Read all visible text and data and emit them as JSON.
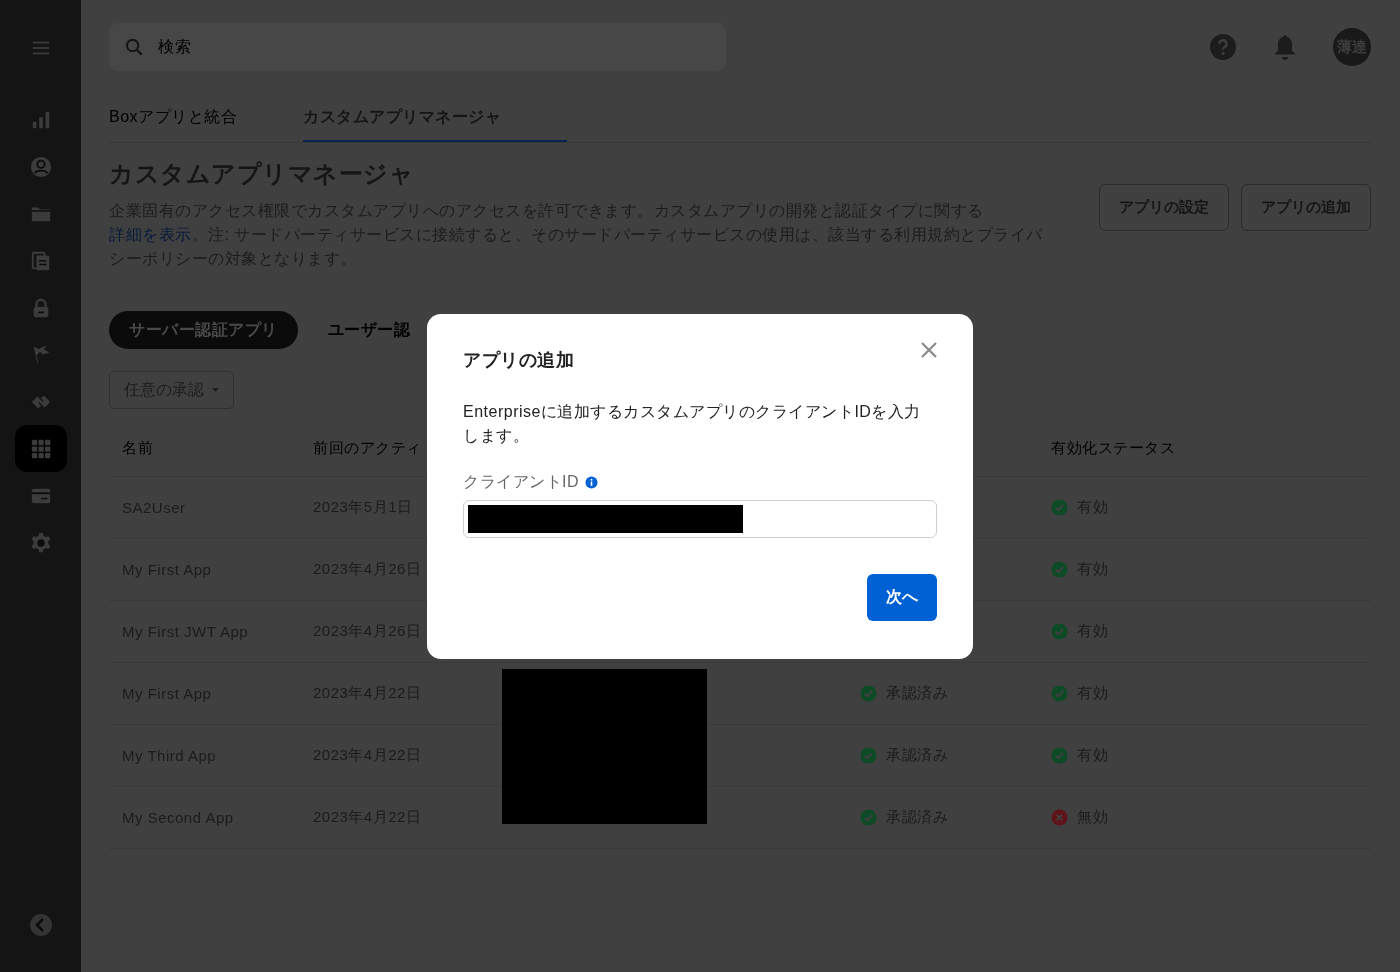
{
  "sidebar": {
    "items": [
      {
        "kind": "chart",
        "selected": false
      },
      {
        "kind": "user",
        "selected": false
      },
      {
        "kind": "folder",
        "selected": false
      },
      {
        "kind": "documents",
        "selected": false
      },
      {
        "kind": "lock",
        "selected": false
      },
      {
        "kind": "flag",
        "selected": false
      },
      {
        "kind": "relay",
        "selected": false
      },
      {
        "kind": "grid",
        "selected": true
      },
      {
        "kind": "card",
        "selected": false
      },
      {
        "kind": "gear",
        "selected": false
      }
    ]
  },
  "search": {
    "placeholder": "検索"
  },
  "avatar": "薄達",
  "tabs": [
    {
      "label": "Boxアプリと統合",
      "selected": false
    },
    {
      "label": "カスタムアプリマネージャ",
      "selected": true
    }
  ],
  "page": {
    "title": "カスタムアプリマネージャ",
    "description": [
      {
        "kind": "text",
        "text": "企業固有のアクセス権限でカスタムアプリへのアクセスを許可できます。カスタムアプリの開発と認証タイプに関する"
      },
      {
        "kind": "link",
        "text": "詳細を表示"
      },
      {
        "kind": "text",
        "text": "。注: サードパーティサービスに接続すると、そのサードパーティサービスの使用は、該当する利用規約とプライバシーポリシーの対象となります。"
      }
    ]
  },
  "actions": [
    "アプリの設定",
    "アプリの追加"
  ],
  "app_types": [
    {
      "label": "サーバー認証アプリ",
      "selected": true
    },
    {
      "label": "ユーザー認",
      "selected": false
    }
  ],
  "filter": {
    "label": "任意の承認"
  },
  "table": {
    "columns": [
      {
        "kind": "name",
        "label": "名前"
      },
      {
        "kind": "activity",
        "label": "前回のアクティ"
      },
      {
        "kind": "status",
        "label": "有効化ステータス"
      }
    ],
    "rows": [
      {
        "name": "SA2User",
        "last_activity": "2023年5月1日",
        "status": {
          "label": "有効",
          "ok": true
        }
      },
      {
        "name": "My First App",
        "last_activity": "2023年4月26日",
        "status": {
          "label": "有効",
          "ok": true
        }
      },
      {
        "name": "My First JWT App",
        "last_activity": "2023年4月26日",
        "status": {
          "label": "有効",
          "ok": true
        }
      },
      {
        "name": "My First App",
        "last_activity": "2023年4月22日",
        "approval": {
          "label": "承認済み",
          "ok": true
        },
        "status": {
          "label": "有効",
          "ok": true
        }
      },
      {
        "name": "My Third App",
        "last_activity": "2023年4月22日",
        "approval": {
          "label": "承認済み",
          "ok": true
        },
        "status": {
          "label": "有効",
          "ok": true
        }
      },
      {
        "name": "My Second App",
        "last_activity": "2023年4月22日",
        "approval": {
          "label": "承認済み",
          "ok": true
        },
        "status": {
          "label": "無効",
          "ok": false
        }
      }
    ]
  },
  "dialog": {
    "title": "アプリの追加",
    "message": "Enterpriseに追加するカスタムアプリのクライアントIDを入力します。",
    "field_label": "クライアントID",
    "next_button": "次へ"
  }
}
